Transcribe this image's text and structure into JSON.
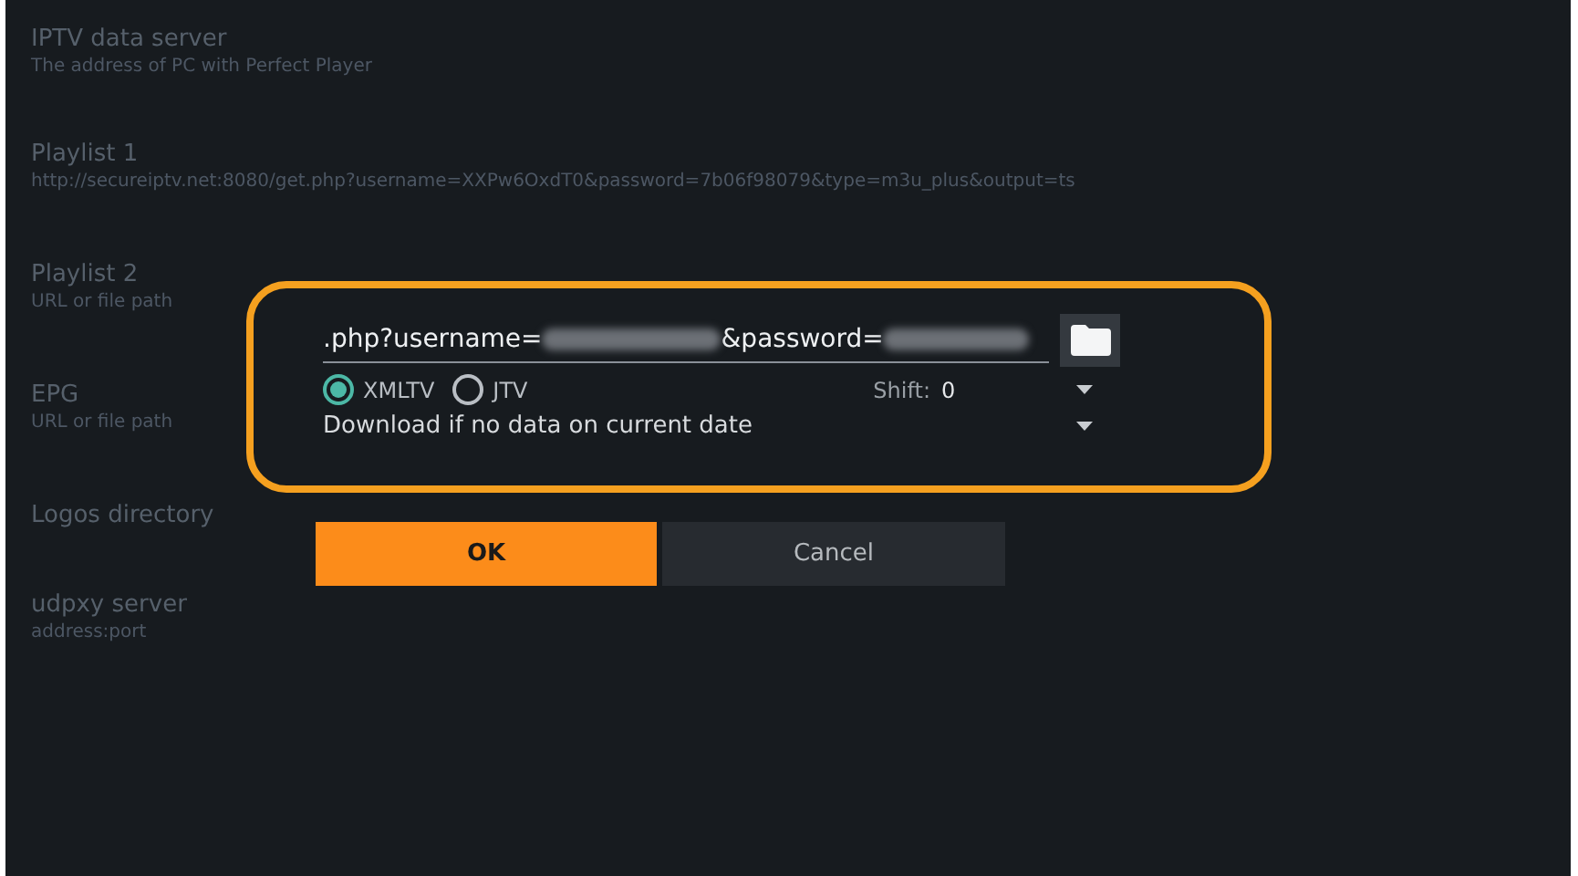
{
  "settings": [
    {
      "title": "IPTV data server",
      "value": "The address of PC with Perfect Player"
    },
    {
      "title": "Playlist 1",
      "value": "http://secureiptv.net:8080/get.php?username=XXPw6OxdT0&password=7b06f98079&type=m3u_plus&output=ts"
    },
    {
      "title": "Playlist 2",
      "value": "URL or file path"
    },
    {
      "title": "EPG",
      "value": "URL or file path"
    },
    {
      "title": "Logos directory"
    },
    {
      "title": "udpxy server",
      "value": "address:port"
    }
  ],
  "dialog": {
    "url_start": ".php?username=",
    "url_middle": "&password=",
    "formats": [
      {
        "label": "XMLTV",
        "selected": true
      },
      {
        "label": "JTV",
        "selected": false
      }
    ],
    "shift_label": "Shift:",
    "shift_value": "0",
    "update_mode": "Download if no data on current date",
    "buttons": [
      {
        "label": "OK",
        "selected": true
      },
      {
        "label": "Cancel",
        "selected": false
      }
    ]
  }
}
